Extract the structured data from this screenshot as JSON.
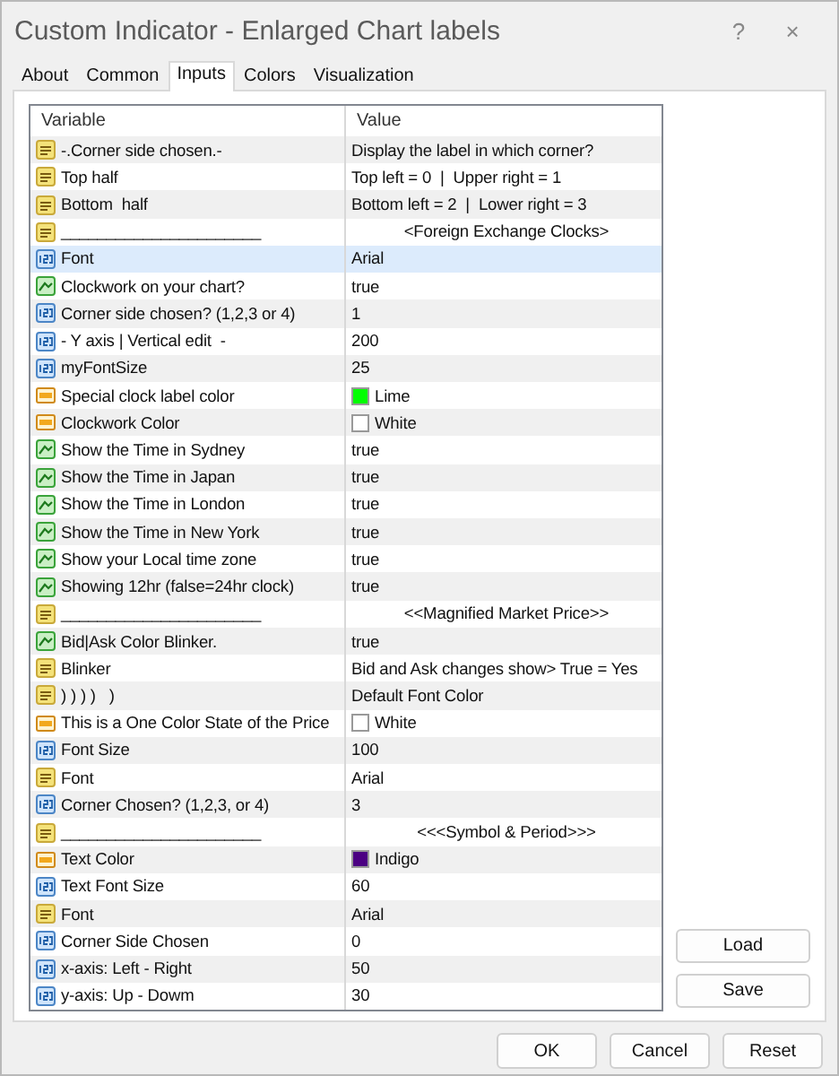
{
  "window": {
    "title": "Custom Indicator - Enlarged Chart labels",
    "help": "?",
    "close": "×"
  },
  "tabs": [
    {
      "label": "About",
      "selected": false
    },
    {
      "label": "Common",
      "selected": false
    },
    {
      "label": "Inputs",
      "selected": true
    },
    {
      "label": "Colors",
      "selected": false
    },
    {
      "label": "Visualization",
      "selected": false
    }
  ],
  "table": {
    "columns": [
      "Variable",
      "Value"
    ],
    "rows": [
      {
        "kind": "string",
        "variable": "-.Corner side chosen.-",
        "value": "Display the label in which corner?",
        "selected": false
      },
      {
        "kind": "string",
        "variable": "Top half",
        "value": "Top left = 0  |  Upper right = 1",
        "selected": false
      },
      {
        "kind": "string",
        "variable": "Bottom  half",
        "value": "Bottom left = 2  |  Lower right = 3",
        "selected": false
      },
      {
        "kind": "separator",
        "variable": "______________________",
        "value": "<Foreign Exchange Clocks>",
        "selected": false
      },
      {
        "kind": "integer",
        "variable": "Font",
        "value": "Arial",
        "selected": true
      },
      {
        "kind": "bool",
        "variable": "Clockwork on your chart?",
        "value": "true",
        "selected": false
      },
      {
        "kind": "integer",
        "variable": "Corner side chosen? (1,2,3 or 4)",
        "value": "1",
        "selected": false
      },
      {
        "kind": "integer",
        "variable": "- Y axis | Vertical edit  -",
        "value": "200",
        "selected": false
      },
      {
        "kind": "integer",
        "variable": "myFontSize",
        "value": "25",
        "selected": false
      },
      {
        "kind": "color",
        "variable": "Special clock label color",
        "value": "Lime",
        "color": "#00ff00",
        "selected": false
      },
      {
        "kind": "color",
        "variable": "Clockwork Color",
        "value": "White",
        "color": "#ffffff",
        "selected": false
      },
      {
        "kind": "bool",
        "variable": "Show the Time in Sydney",
        "value": "true",
        "selected": false
      },
      {
        "kind": "bool",
        "variable": "Show the Time in Japan",
        "value": "true",
        "selected": false
      },
      {
        "kind": "bool",
        "variable": "Show the Time in London",
        "value": "true",
        "selected": false
      },
      {
        "kind": "bool",
        "variable": "Show the Time in New York",
        "value": "true",
        "selected": false
      },
      {
        "kind": "bool",
        "variable": "Show your Local time zone",
        "value": "true",
        "selected": false
      },
      {
        "kind": "bool",
        "variable": "Showing 12hr (false=24hr clock)",
        "value": "true",
        "selected": false
      },
      {
        "kind": "separator",
        "variable": "______________________",
        "value": "<<Magnified Market Price>>",
        "selected": false
      },
      {
        "kind": "bool",
        "variable": "Bid|Ask Color Blinker.",
        "value": "true",
        "selected": false
      },
      {
        "kind": "string",
        "variable": "Blinker",
        "value": "Bid and Ask changes show> True = Yes",
        "selected": false
      },
      {
        "kind": "string",
        "variable": ") ) ) )   )",
        "value": "Default Font Color",
        "selected": false
      },
      {
        "kind": "color",
        "variable": "This is a One Color State of the Price",
        "value": "White",
        "color": "#ffffff",
        "selected": false
      },
      {
        "kind": "integer",
        "variable": "Font Size",
        "value": "100",
        "selected": false
      },
      {
        "kind": "string",
        "variable": "Font",
        "value": "Arial",
        "selected": false
      },
      {
        "kind": "integer",
        "variable": "Corner Chosen? (1,2,3, or 4)",
        "value": "3",
        "selected": false
      },
      {
        "kind": "separator",
        "variable": "______________________",
        "value": "<<<Symbol & Period>>>",
        "selected": false
      },
      {
        "kind": "color",
        "variable": "Text Color",
        "value": "Indigo",
        "color": "#4b0082",
        "selected": false
      },
      {
        "kind": "integer",
        "variable": "Text Font Size",
        "value": "60",
        "selected": false
      },
      {
        "kind": "string",
        "variable": "Font",
        "value": "Arial",
        "selected": false
      },
      {
        "kind": "integer",
        "variable": "Corner Side Chosen",
        "value": "0",
        "selected": false
      },
      {
        "kind": "integer",
        "variable": "x-axis: Left - Right",
        "value": "50",
        "selected": false
      },
      {
        "kind": "integer",
        "variable": "y-axis: Up - Dowm",
        "value": "30",
        "selected": false
      }
    ]
  },
  "side_buttons": [
    "Load",
    "Save"
  ],
  "buttons": [
    "OK",
    "Cancel",
    "Reset"
  ]
}
